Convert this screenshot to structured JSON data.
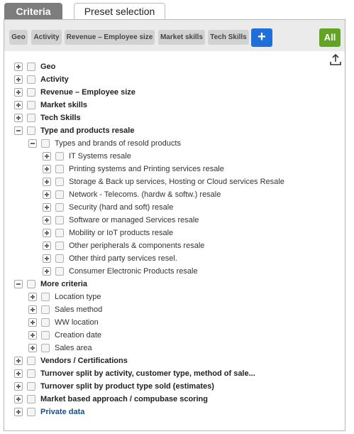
{
  "tabs": {
    "criteria": "Criteria",
    "preset": "Preset selection"
  },
  "toolbar": {
    "chips": [
      "Geo",
      "Activity",
      "Revenue – Employee size",
      "Market skills",
      "Tech Skills"
    ],
    "add_label": "+",
    "all_label": "All"
  },
  "tree": [
    {
      "label": "Geo",
      "level": 0,
      "state": "collapsed",
      "style": "bold"
    },
    {
      "label": "Activity",
      "level": 0,
      "state": "collapsed",
      "style": "bold"
    },
    {
      "label": "Revenue – Employee size",
      "level": 0,
      "state": "collapsed",
      "style": "bold"
    },
    {
      "label": "Market skills",
      "level": 0,
      "state": "collapsed",
      "style": "bold"
    },
    {
      "label": "Tech Skills",
      "level": 0,
      "state": "collapsed",
      "style": "bold"
    },
    {
      "label": "Type and products resale",
      "level": 0,
      "state": "expanded",
      "style": "bold"
    },
    {
      "label": "Types and brands of resold products",
      "level": 1,
      "state": "expanded",
      "style": "normal"
    },
    {
      "label": "IT Systems resale",
      "level": 2,
      "state": "collapsed",
      "style": "normal"
    },
    {
      "label": "Printing systems and Printing services resale",
      "level": 2,
      "state": "collapsed",
      "style": "normal"
    },
    {
      "label": "Storage & Back up services, Hosting or Cloud services Resale",
      "level": 2,
      "state": "collapsed",
      "style": "normal"
    },
    {
      "label": "Network - Telecoms. (hardw & softw.) resale",
      "level": 2,
      "state": "collapsed",
      "style": "normal"
    },
    {
      "label": "Security (hard and soft) resale",
      "level": 2,
      "state": "collapsed",
      "style": "normal"
    },
    {
      "label": "Software or managed Services resale",
      "level": 2,
      "state": "collapsed",
      "style": "normal"
    },
    {
      "label": "Mobility or IoT products resale",
      "level": 2,
      "state": "collapsed",
      "style": "normal"
    },
    {
      "label": "Other peripherals & components resale",
      "level": 2,
      "state": "collapsed",
      "style": "normal"
    },
    {
      "label": "Other third party services resel.",
      "level": 2,
      "state": "collapsed",
      "style": "normal"
    },
    {
      "label": "Consumer Electronic Products resale",
      "level": 2,
      "state": "collapsed",
      "style": "normal"
    },
    {
      "label": "More criteria",
      "level": 0,
      "state": "expanded",
      "style": "bold"
    },
    {
      "label": "Location type",
      "level": 1,
      "state": "collapsed",
      "style": "normal"
    },
    {
      "label": "Sales method",
      "level": 1,
      "state": "collapsed",
      "style": "normal"
    },
    {
      "label": "WW location",
      "level": 1,
      "state": "collapsed",
      "style": "normal"
    },
    {
      "label": "Creation date",
      "level": 1,
      "state": "collapsed",
      "style": "normal"
    },
    {
      "label": "Sales area",
      "level": 1,
      "state": "collapsed",
      "style": "normal"
    },
    {
      "label": "Vendors / Certifications",
      "level": 0,
      "state": "collapsed",
      "style": "bold"
    },
    {
      "label": "Turnover split by activity, customer type, method of sale...",
      "level": 0,
      "state": "collapsed",
      "style": "bold"
    },
    {
      "label": "Turnover split by product type sold (estimates)",
      "level": 0,
      "state": "collapsed",
      "style": "bold"
    },
    {
      "label": "Market based approach / compubase scoring",
      "level": 0,
      "state": "collapsed",
      "style": "bold"
    },
    {
      "label": "Private data",
      "level": 0,
      "state": "collapsed",
      "style": "link"
    }
  ],
  "colors": {
    "add_button": "#1f6fdb",
    "all_button": "#62a524",
    "active_tab": "#7d7d7d",
    "link": "#1a4d8c"
  },
  "icons": {
    "add": "plus-icon",
    "export": "upload-icon"
  }
}
